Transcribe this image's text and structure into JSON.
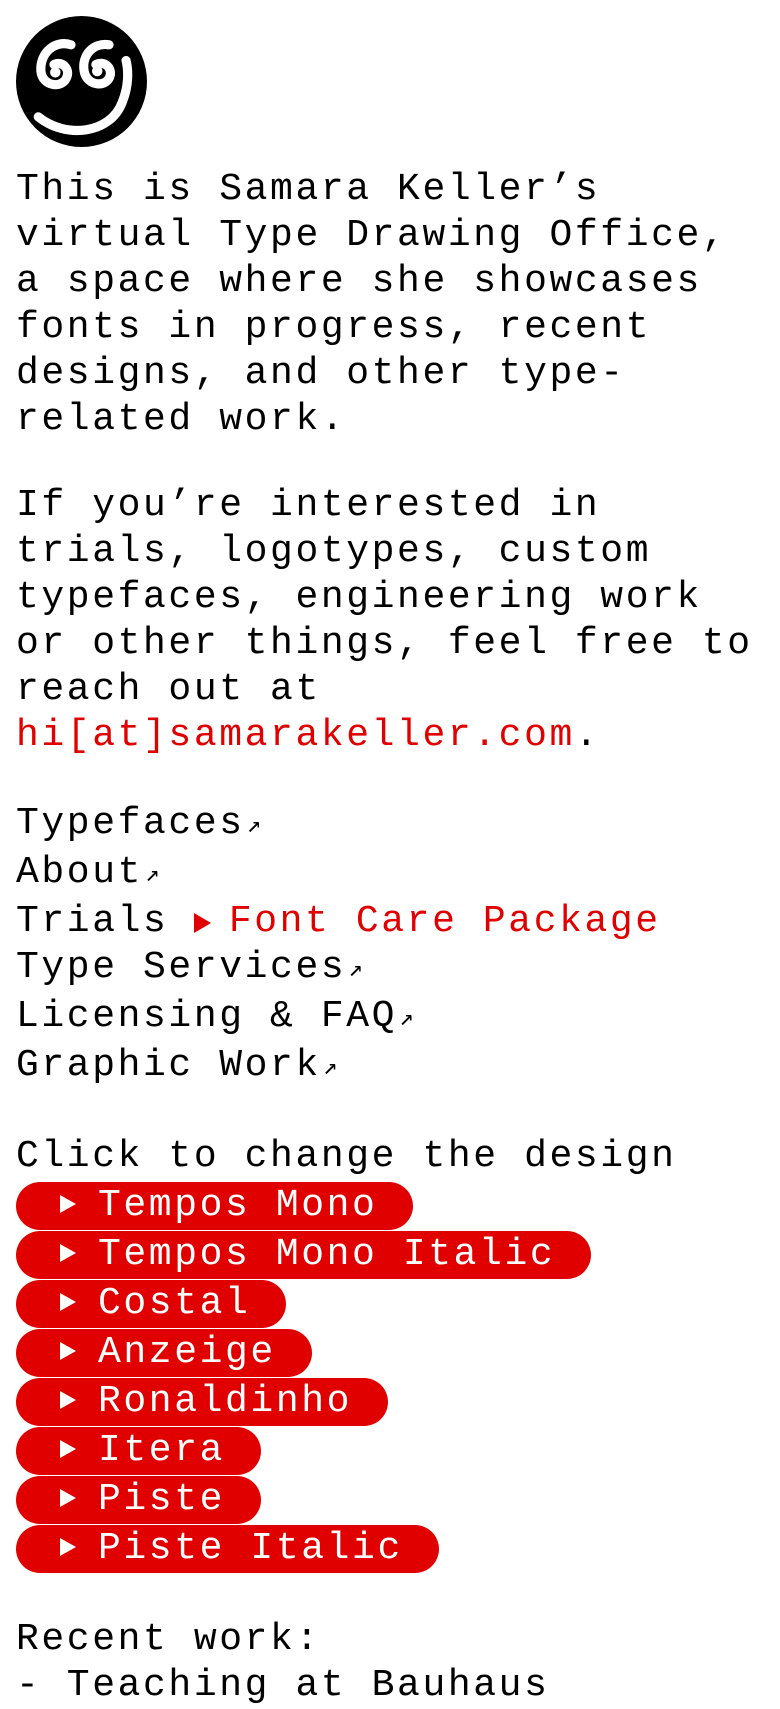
{
  "logo": {
    "name": "smiley-quote-logo",
    "color": "#000000"
  },
  "intro": {
    "text": "This is Samara Keller’s virtual Type Drawing Office, a space where she showcases fonts in progress, recent designs, and other type-related work."
  },
  "contact": {
    "text": "If you’re interested in trials, logotypes, custom typefaces, engineering work or other things, feel free to reach out at ",
    "email": "hi[at]samarakeller.com",
    "end": "."
  },
  "nav": {
    "arrow_glyph": "↗",
    "items": [
      {
        "label": "Typefaces"
      },
      {
        "label": "About"
      },
      {
        "label": "Trials",
        "extra": "Font Care Package"
      },
      {
        "label": "Type Services"
      },
      {
        "label": "Licensing & FAQ"
      },
      {
        "label": "Graphic Work"
      }
    ]
  },
  "designs": {
    "heading": "Click to change the design",
    "options": [
      "Tempos Mono",
      "Tempos Mono Italic",
      "Costal",
      "Anzeige",
      "Ronaldinho",
      "Itera",
      "Piste",
      "Piste Italic"
    ]
  },
  "recent": {
    "heading": "Recent work:",
    "items": [
      "- Teaching at Bauhaus"
    ]
  },
  "colors": {
    "accent": "#e00000",
    "text": "#000000",
    "background": "#ffffff"
  }
}
